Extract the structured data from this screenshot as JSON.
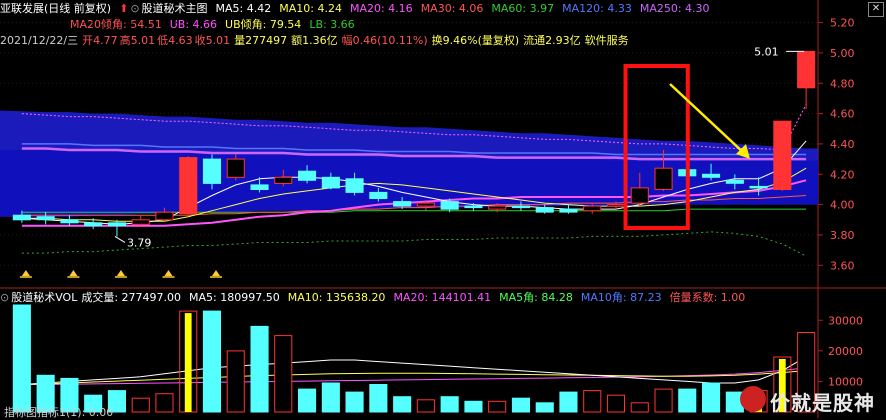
{
  "colors": {
    "up": "#ff3333",
    "down": "#55ffff",
    "ma5": "#ffffff",
    "ma10": "#ffff55",
    "ma20": "#ff55ff",
    "ma30": "#ff5555",
    "ma60": "#33cc33",
    "ma120": "#5577ff",
    "ma250": "#cc66ff",
    "vol_ma5": "#ffffff",
    "vol_ma10": "#ffff55",
    "vol_ma20": "#ff55ff"
  },
  "header": {
    "title": "亚联发展(日线 前复权)",
    "indicator_name": "股道秘术主图",
    "ma5": "MA5: 4.42",
    "ma10": "MA10: 4.24",
    "ma20": "MA20: 4.16",
    "ma30": "MA30: 4.06",
    "ma60": "MA60: 3.97",
    "ma120": "MA120: 4.33",
    "ma250": "MA250: 4.30"
  },
  "header2": {
    "ma20_angle": "MA20倾角: 54.51",
    "ub": "UB: 4.66",
    "ub_angle": "UB倾角: 79.54",
    "lb": "LB: 3.66"
  },
  "info": {
    "date": "2021/12/22/三",
    "open": "开4.77",
    "high": "高5.01",
    "low": "低4.63",
    "close": "收5.01",
    "volume": "量277497",
    "amount": "额1.36亿",
    "change": "幅0.46(10.11%)",
    "turnover": "换9.46%(量复权)",
    "float": "流通2.93亿",
    "industry": "软件服务"
  },
  "price_annotations": {
    "last_price": "5.01",
    "low_mark": "3.79"
  },
  "vol_header": {
    "name": "股道秘术VOL",
    "volume": "成交量: 277497.00",
    "ma5": "MA5: 180997.50",
    "ma10": "MA10: 135638.20",
    "ma20": "MA20: 144101.41",
    "ma5_angle": "MA5角: 84.28",
    "ma10_angle": "MA10角: 87.23",
    "multiplier": "倍量系数: 1.00"
  },
  "bottom_label": "指标图指标1(1): 0.00",
  "watermark": "价就是股神",
  "chart_data": [
    {
      "type": "candlestick",
      "ylim": [
        3.45,
        5.25
      ],
      "yticks": [
        "3.60",
        "3.80",
        "4.00",
        "4.20",
        "4.40",
        "4.60",
        "4.80",
        "5.00",
        "5.20"
      ],
      "candles": [
        {
          "o": 3.93,
          "c": 3.9,
          "h": 3.96,
          "l": 3.88
        },
        {
          "o": 3.92,
          "c": 3.9,
          "h": 3.95,
          "l": 3.87
        },
        {
          "o": 3.9,
          "c": 3.88,
          "h": 3.93,
          "l": 3.86
        },
        {
          "o": 3.88,
          "c": 3.86,
          "h": 3.91,
          "l": 3.84
        },
        {
          "o": 3.88,
          "c": 3.86,
          "h": 3.9,
          "l": 3.79
        },
        {
          "o": 3.87,
          "c": 3.9,
          "h": 3.93,
          "l": 3.86
        },
        {
          "o": 3.9,
          "c": 3.95,
          "h": 3.98,
          "l": 3.89
        },
        {
          "o": 3.94,
          "c": 4.31,
          "h": 4.32,
          "l": 3.93
        },
        {
          "o": 4.3,
          "c": 4.14,
          "h": 4.33,
          "l": 4.1
        },
        {
          "o": 4.18,
          "c": 4.3,
          "h": 4.33,
          "l": 4.16
        },
        {
          "o": 4.13,
          "c": 4.1,
          "h": 4.18,
          "l": 4.08
        },
        {
          "o": 4.14,
          "c": 4.18,
          "h": 4.23,
          "l": 4.12
        },
        {
          "o": 4.22,
          "c": 4.16,
          "h": 4.26,
          "l": 4.14
        },
        {
          "o": 4.18,
          "c": 4.11,
          "h": 4.21,
          "l": 4.1
        },
        {
          "o": 4.17,
          "c": 4.08,
          "h": 4.21,
          "l": 4.06
        },
        {
          "o": 4.08,
          "c": 4.04,
          "h": 4.11,
          "l": 4.02
        },
        {
          "o": 4.02,
          "c": 3.99,
          "h": 4.05,
          "l": 3.97
        },
        {
          "o": 3.99,
          "c": 4.01,
          "h": 4.03,
          "l": 3.96
        },
        {
          "o": 4.02,
          "c": 3.97,
          "h": 4.04,
          "l": 3.95
        },
        {
          "o": 3.99,
          "c": 3.98,
          "h": 4.01,
          "l": 3.96
        },
        {
          "o": 3.97,
          "c": 3.99,
          "h": 4.01,
          "l": 3.95
        },
        {
          "o": 3.99,
          "c": 3.98,
          "h": 4.02,
          "l": 3.96
        },
        {
          "o": 3.98,
          "c": 3.95,
          "h": 4.0,
          "l": 3.94
        },
        {
          "o": 3.97,
          "c": 3.95,
          "h": 4.0,
          "l": 3.94
        },
        {
          "o": 3.96,
          "c": 3.99,
          "h": 4.01,
          "l": 3.94
        },
        {
          "o": 3.99,
          "c": 4.0,
          "h": 4.02,
          "l": 3.97
        },
        {
          "o": 4.01,
          "c": 4.11,
          "h": 4.21,
          "l": 3.99
        },
        {
          "o": 4.1,
          "c": 4.24,
          "h": 4.36,
          "l": 4.09
        },
        {
          "o": 4.23,
          "c": 4.19,
          "h": 4.43,
          "l": 4.18
        },
        {
          "o": 4.2,
          "c": 4.18,
          "h": 4.27,
          "l": 4.16
        },
        {
          "o": 4.16,
          "c": 4.14,
          "h": 4.2,
          "l": 4.1
        },
        {
          "o": 4.12,
          "c": 4.11,
          "h": 4.18,
          "l": 4.06
        },
        {
          "o": 4.1,
          "c": 4.55,
          "h": 4.55,
          "l": 4.09
        },
        {
          "o": 4.77,
          "c": 5.01,
          "h": 5.01,
          "l": 4.63
        }
      ],
      "ma5": [
        3.91,
        3.9,
        3.89,
        3.88,
        3.87,
        3.88,
        3.9,
        3.98,
        4.06,
        4.13,
        4.17,
        4.18,
        4.18,
        4.17,
        4.15,
        4.12,
        4.08,
        4.05,
        4.02,
        4.0,
        3.99,
        3.99,
        3.98,
        3.97,
        3.97,
        3.97,
        4.0,
        4.05,
        4.1,
        4.14,
        4.17,
        4.17,
        4.24,
        4.42
      ],
      "ma10": [
        3.91,
        3.91,
        3.9,
        3.9,
        3.89,
        3.89,
        3.89,
        3.92,
        3.96,
        4.0,
        4.04,
        4.07,
        4.09,
        4.11,
        4.13,
        4.14,
        4.13,
        4.11,
        4.09,
        4.07,
        4.05,
        4.03,
        4.01,
        4.0,
        3.99,
        3.99,
        3.99,
        4.0,
        4.02,
        4.05,
        4.08,
        4.1,
        4.15,
        4.24
      ],
      "ma20": [
        3.86,
        3.86,
        3.86,
        3.86,
        3.86,
        3.86,
        3.86,
        3.87,
        3.88,
        3.9,
        3.92,
        3.93,
        3.95,
        3.96,
        3.98,
        4.0,
        4.01,
        4.02,
        4.03,
        4.04,
        4.04,
        4.05,
        4.05,
        4.05,
        4.05,
        4.05,
        4.05,
        4.06,
        4.06,
        4.07,
        4.08,
        4.09,
        4.12,
        4.16
      ],
      "ma30": [
        3.93,
        3.93,
        3.93,
        3.93,
        3.93,
        3.93,
        3.93,
        3.93,
        3.94,
        3.94,
        3.95,
        3.95,
        3.96,
        3.96,
        3.97,
        3.97,
        3.98,
        3.98,
        3.99,
        3.99,
        4.0,
        4.0,
        4.0,
        4.01,
        4.01,
        4.01,
        4.02,
        4.02,
        4.03,
        4.03,
        4.04,
        4.04,
        4.05,
        4.06
      ],
      "ma60": [
        3.95,
        3.95,
        3.95,
        3.95,
        3.95,
        3.95,
        3.95,
        3.95,
        3.95,
        3.95,
        3.95,
        3.95,
        3.95,
        3.95,
        3.96,
        3.96,
        3.96,
        3.96,
        3.96,
        3.96,
        3.96,
        3.96,
        3.96,
        3.96,
        3.96,
        3.96,
        3.96,
        3.96,
        3.97,
        3.97,
        3.97,
        3.97,
        3.97,
        3.97
      ],
      "ma120": [
        4.4,
        4.4,
        4.4,
        4.39,
        4.39,
        4.39,
        4.38,
        4.38,
        4.38,
        4.37,
        4.37,
        4.37,
        4.36,
        4.36,
        4.36,
        4.35,
        4.35,
        4.35,
        4.35,
        4.34,
        4.34,
        4.34,
        4.34,
        4.34,
        4.34,
        4.33,
        4.33,
        4.33,
        4.33,
        4.33,
        4.33,
        4.33,
        4.33,
        4.33
      ],
      "ma250": [
        4.37,
        4.37,
        4.36,
        4.36,
        4.36,
        4.35,
        4.35,
        4.35,
        4.34,
        4.34,
        4.34,
        4.34,
        4.33,
        4.33,
        4.33,
        4.33,
        4.32,
        4.32,
        4.32,
        4.32,
        4.31,
        4.31,
        4.31,
        4.31,
        4.31,
        4.31,
        4.3,
        4.3,
        4.3,
        4.3,
        4.3,
        4.3,
        4.3,
        4.3
      ],
      "ub": [
        4.6,
        4.59,
        4.58,
        4.58,
        4.57,
        4.56,
        4.55,
        4.55,
        4.54,
        4.53,
        4.52,
        4.52,
        4.51,
        4.5,
        4.49,
        4.49,
        4.48,
        4.47,
        4.46,
        4.46,
        4.45,
        4.44,
        4.43,
        4.43,
        4.42,
        4.41,
        4.4,
        4.4,
        4.39,
        4.38,
        4.37,
        4.37,
        4.36,
        4.66
      ],
      "lb": [
        3.68,
        3.68,
        3.69,
        3.69,
        3.7,
        3.71,
        3.72,
        3.73,
        3.73,
        3.74,
        3.75,
        3.75,
        3.75,
        3.76,
        3.76,
        3.76,
        3.76,
        3.77,
        3.77,
        3.77,
        3.78,
        3.78,
        3.78,
        3.78,
        3.79,
        3.79,
        3.79,
        3.8,
        3.81,
        3.82,
        3.81,
        3.79,
        3.74,
        3.66
      ],
      "band_top": [
        4.62,
        4.61,
        4.61,
        4.6,
        4.6,
        4.59,
        4.58,
        4.58,
        4.57,
        4.56,
        4.56,
        4.55,
        4.54,
        4.54,
        4.53,
        4.52,
        4.51,
        4.51,
        4.5,
        4.49,
        4.48,
        4.47,
        4.47,
        4.46,
        4.45,
        4.44,
        4.43,
        4.42,
        4.42,
        4.41,
        4.4,
        4.39,
        4.38,
        4.37
      ],
      "band_bottom": [
        3.92,
        3.92,
        3.92,
        3.93,
        3.93,
        3.94,
        3.94,
        3.95,
        3.95,
        3.95,
        3.96,
        3.96,
        3.96,
        3.97,
        3.97,
        3.97,
        3.98,
        3.98,
        3.98,
        3.98,
        3.99,
        3.99,
        3.99,
        3.99,
        3.99,
        4.0,
        4.0,
        4.0,
        4.0,
        4.0,
        4.0,
        4.0,
        4.0,
        4.0
      ],
      "buy_signals": [
        0,
        2,
        4,
        6,
        8
      ]
    },
    {
      "type": "bar",
      "ylim": [
        0,
        35000
      ],
      "yticks": [
        "10000",
        "20000",
        "30000"
      ],
      "volumes": [
        35000,
        12000,
        11000,
        5500,
        7000,
        4500,
        6000,
        33000,
        33000,
        20000,
        28000,
        25000,
        7500,
        9500,
        6500,
        9000,
        5000,
        4000,
        5000,
        3500,
        3500,
        4500,
        3000,
        6500,
        7000,
        5500,
        3000,
        7500,
        7500,
        9500,
        6500,
        7000,
        18000,
        26000
      ],
      "highlight": [
        7,
        31,
        32
      ],
      "vol_ma5": [
        9000,
        9500,
        10000,
        10500,
        11000,
        11500,
        12500,
        13500,
        14500,
        15000,
        15500,
        16000,
        16500,
        17000,
        17000,
        16500,
        16000,
        15500,
        15000,
        14500,
        14000,
        13500,
        13000,
        12500,
        12000,
        11500,
        11000,
        10500,
        10000,
        9500,
        9500,
        10500,
        13500,
        18099
      ],
      "vol_ma10": [
        9000,
        9200,
        9500,
        9800,
        10100,
        10400,
        10700,
        11000,
        11300,
        11600,
        11900,
        12100,
        12300,
        12500,
        12600,
        12700,
        12700,
        12700,
        12600,
        12500,
        12400,
        12300,
        12200,
        12100,
        12000,
        11900,
        11800,
        11700,
        11700,
        11800,
        12000,
        12400,
        12900,
        13563
      ],
      "vol_ma20": [
        9000,
        9000,
        9100,
        9200,
        9300,
        9400,
        9500,
        9600,
        9700,
        9800,
        9900,
        10000,
        10100,
        10200,
        10300,
        10400,
        10500,
        10600,
        10700,
        10800,
        10900,
        11000,
        11100,
        11200,
        11300,
        11400,
        11500,
        11700,
        11900,
        12100,
        12400,
        12900,
        13600,
        14410
      ]
    }
  ]
}
